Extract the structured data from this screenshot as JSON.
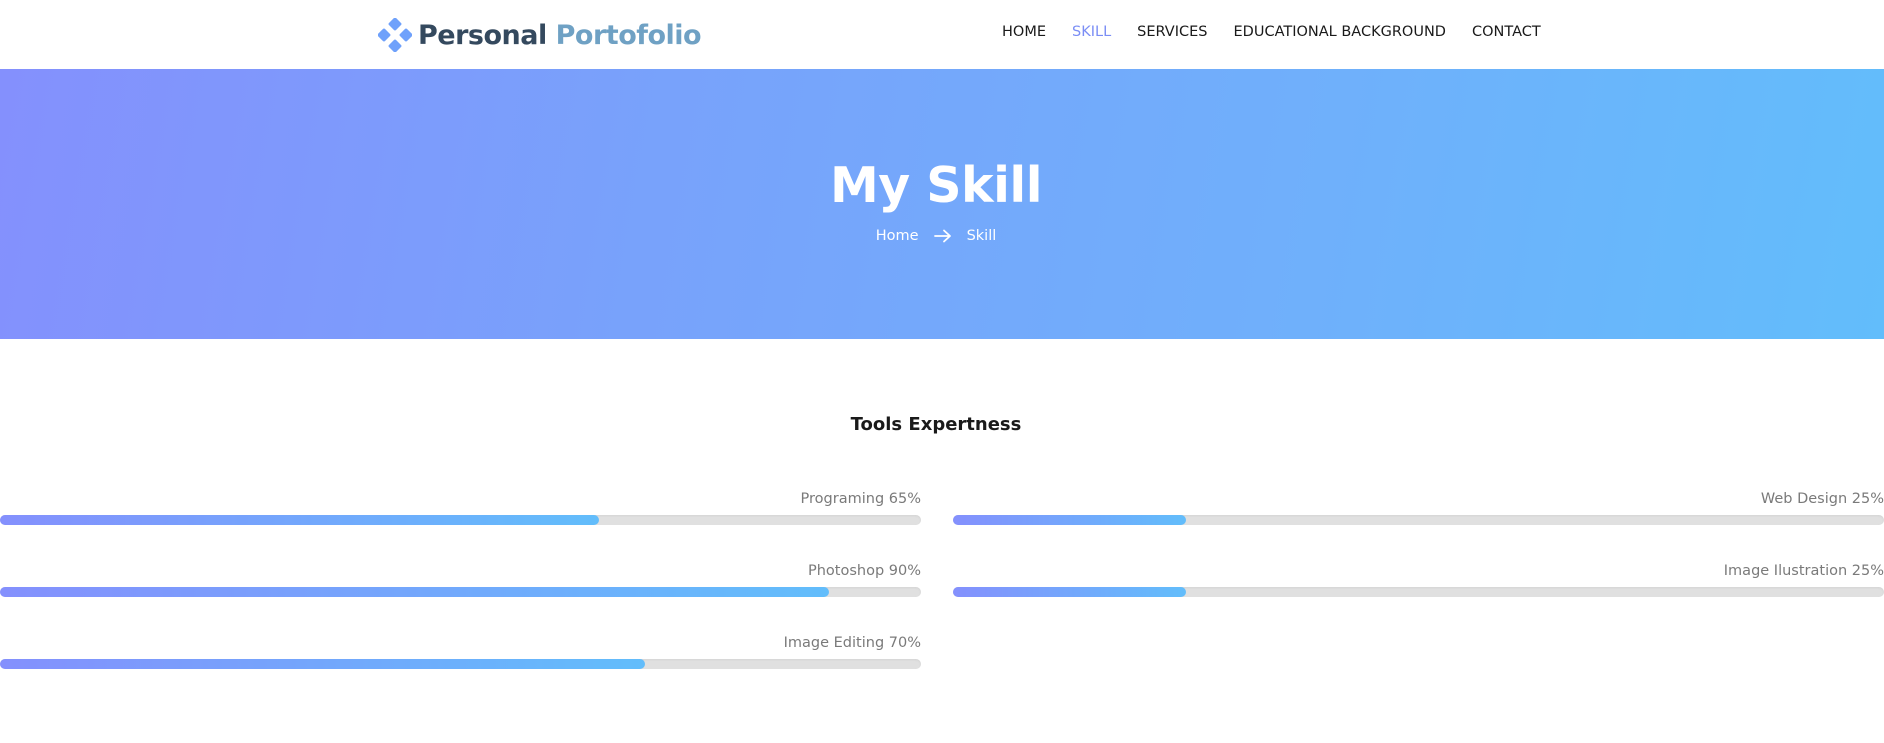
{
  "header": {
    "logo": {
      "part1": "Personal",
      "part2": "Portofolio",
      "icon": "diamond-logo-icon"
    },
    "nav": [
      {
        "label": "HOME",
        "active": false
      },
      {
        "label": "SKILL",
        "active": true
      },
      {
        "label": "SERVICES",
        "active": false
      },
      {
        "label": "EDUCATIONAL BACKGROUND",
        "active": false
      },
      {
        "label": "CONTACT",
        "active": false
      }
    ]
  },
  "banner": {
    "title": "My Skill",
    "breadcrumb": {
      "home": "Home",
      "separator_icon": "arrow-right-icon",
      "current": "Skill"
    }
  },
  "skills": {
    "title": "Tools Expertness",
    "left": [
      {
        "label": "Programing 65%",
        "percent": 65
      },
      {
        "label": "Photoshop 90%",
        "percent": 90
      },
      {
        "label": "Image Editing 70%",
        "percent": 70
      }
    ],
    "right": [
      {
        "label": "Web Design 25%",
        "percent": 25
      },
      {
        "label": "Image Ilustration 25%",
        "percent": 25
      }
    ]
  },
  "colors": {
    "accent": "#7b8ef5",
    "gradient_start": "#8490fd",
    "gradient_end": "#62bdfb",
    "logo_dark": "#34495e",
    "logo_light": "#6fa1c4"
  }
}
